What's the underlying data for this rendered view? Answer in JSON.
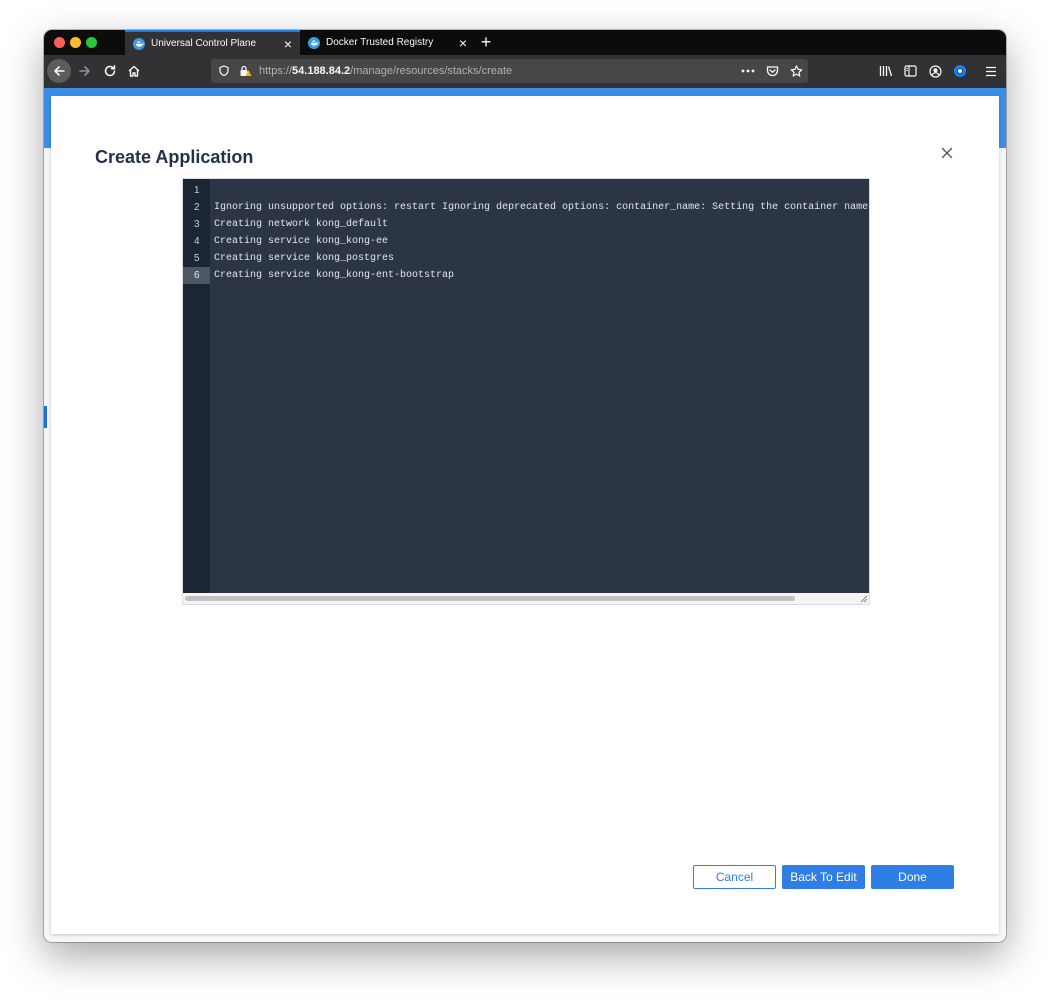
{
  "browser": {
    "tabs": [
      {
        "title": "Universal Control Plane",
        "active": true
      },
      {
        "title": "Docker Trusted Registry",
        "active": false
      }
    ],
    "newtab_label": "+",
    "url": {
      "scheme": "https://",
      "host": "54.188.84.2",
      "path": "/manage/resources/stacks/create"
    },
    "colors": {
      "accent": "#0a84ff",
      "favicon": "#3b9ae1"
    }
  },
  "modal": {
    "title": "Create Application",
    "close_icon": "close-icon"
  },
  "editor": {
    "lines": [
      {
        "number": "1",
        "text": ""
      },
      {
        "number": "2",
        "text": "Ignoring unsupported options: restart Ignoring deprecated options: container_name: Setting the container name is not s"
      },
      {
        "number": "3",
        "text": "Creating network kong_default"
      },
      {
        "number": "4",
        "text": "Creating service kong_kong-ee"
      },
      {
        "number": "5",
        "text": "Creating service kong_postgres"
      },
      {
        "number": "6",
        "text": "Creating service kong_kong-ent-bootstrap"
      }
    ],
    "current_line": "6"
  },
  "actions": {
    "cancel_label": "Cancel",
    "back_label": "Back To Edit",
    "done_label": "Done"
  },
  "theme": {
    "primary": "#2e7ee6",
    "header_band": "#3a8ee6",
    "editor_bg": "#2b3545"
  }
}
